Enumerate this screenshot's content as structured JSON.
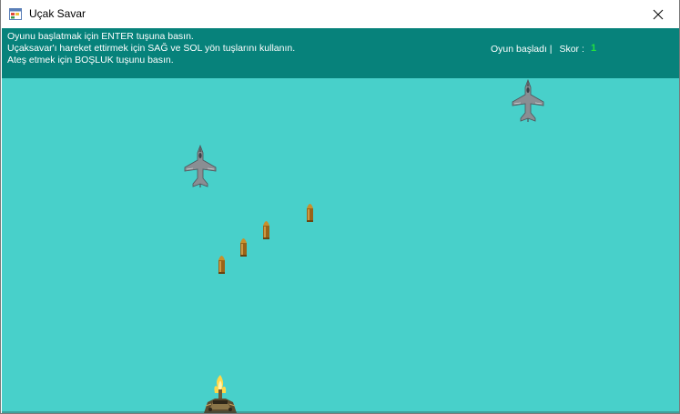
{
  "window": {
    "title": "Uçak Savar",
    "icon": "windows-form-icon",
    "close_icon": "close-icon"
  },
  "header": {
    "instructions": [
      "Oyunu başlatmak için ENTER tuşuna basın.",
      "Uçaksavar'ı hareket ettirmek için SAĞ ve SOL yön tuşlarını kullanın.",
      "Ateş etmek için BOŞLUK tuşunu basın."
    ],
    "status": "Oyun başladı |",
    "score_label": "Skor :",
    "score_value": "1",
    "colors": {
      "header_bg": "#07827b",
      "score_color": "#22e040"
    }
  },
  "game": {
    "background_color": "#48d0ca",
    "enemy_planes": [
      {
        "icon": "fighter-jet-icon"
      },
      {
        "icon": "fighter-jet-icon"
      }
    ],
    "bullets": [
      {
        "icon": "bullet-icon"
      },
      {
        "icon": "bullet-icon"
      },
      {
        "icon": "bullet-icon"
      },
      {
        "icon": "bullet-icon"
      }
    ],
    "player": {
      "icon": "anti-aircraft-gun-icon"
    }
  }
}
